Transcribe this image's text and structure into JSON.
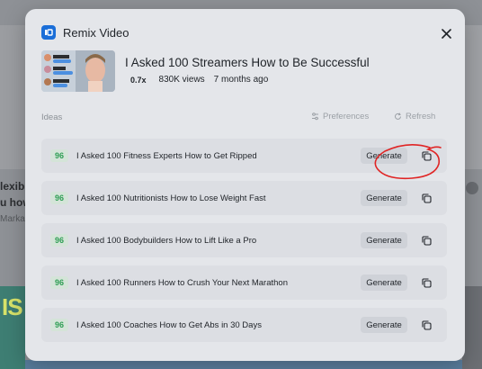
{
  "background": {
    "left_text_line1": "lexibl",
    "left_text_line2": "u how",
    "left_text_line3": "Marka",
    "bottom_left_text": "IS"
  },
  "modal": {
    "title": "Remix Video",
    "brand_color": "#1a6ed8",
    "close_icon": "close-icon"
  },
  "video": {
    "title": "I Asked 100 Streamers How to Be Successful",
    "speed": "0.7x",
    "views": "830K views",
    "age": "7 months ago",
    "thumb_chat": [
      "Gileegeh",
      "Embla",
      "Kenmeng2"
    ]
  },
  "ideas": {
    "label": "Ideas",
    "preferences_label": "Preferences",
    "refresh_label": "Refresh",
    "items": [
      {
        "score": "96",
        "text": "I Asked 100 Fitness Experts How to Get Ripped",
        "button": "Generate"
      },
      {
        "score": "96",
        "text": "I Asked 100 Nutritionists How to Lose Weight Fast",
        "button": "Generate"
      },
      {
        "score": "96",
        "text": "I Asked 100 Bodybuilders How to Lift Like a Pro",
        "button": "Generate"
      },
      {
        "score": "96",
        "text": "I Asked 100 Runners How to Crush Your Next Marathon",
        "button": "Generate"
      },
      {
        "score": "96",
        "text": "I Asked 100 Coaches How to Get Abs in 30 Days",
        "button": "Generate"
      }
    ]
  },
  "colors": {
    "score_green": "#2f9e54",
    "highlight_red": "#e02424"
  }
}
